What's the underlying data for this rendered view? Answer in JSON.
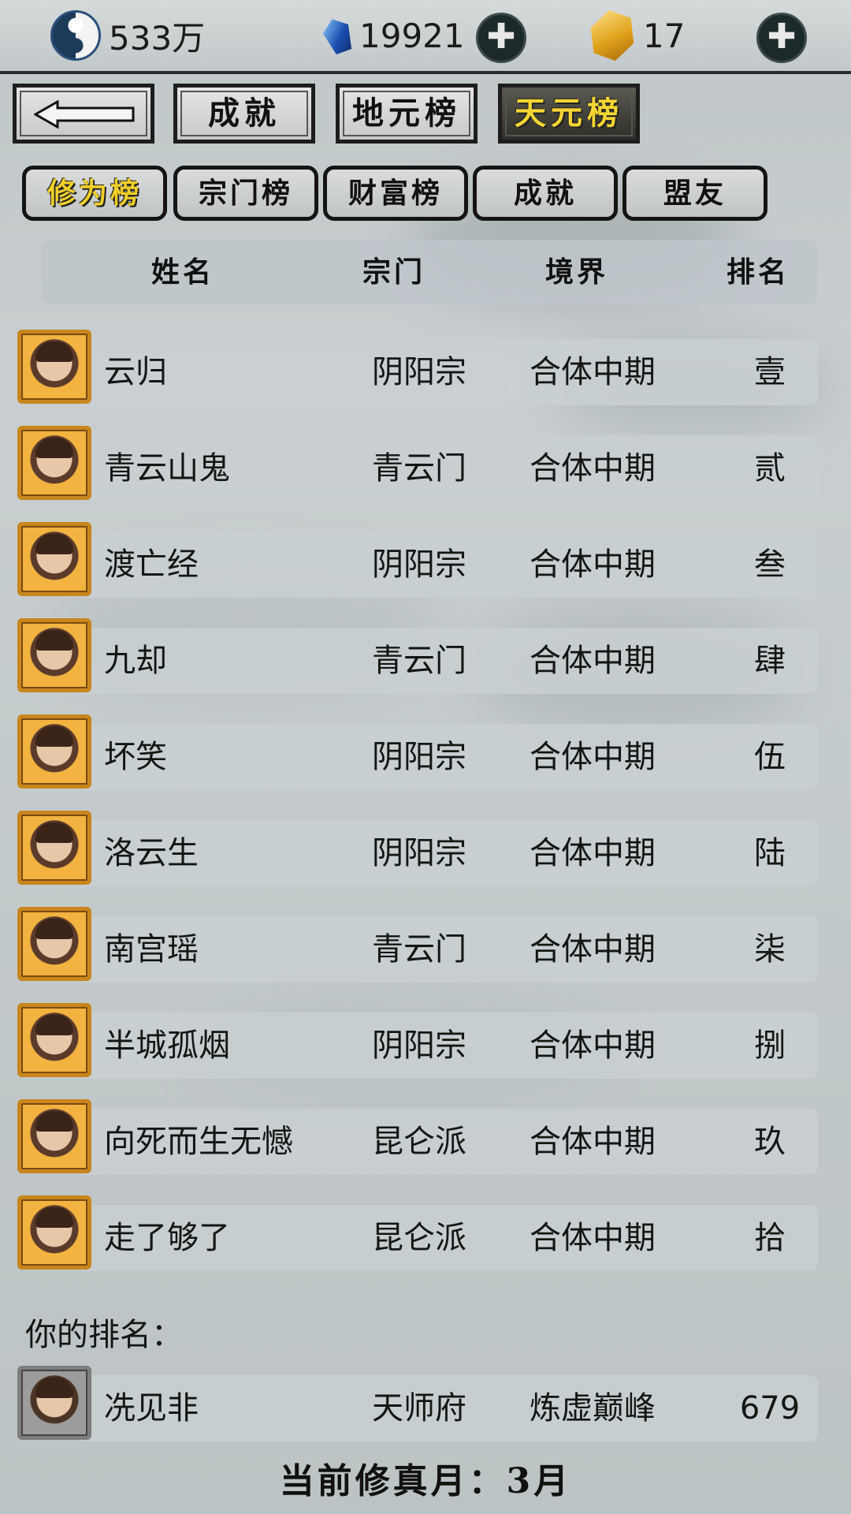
{
  "resources": {
    "spirit_stones": "533万",
    "gems": "19921",
    "gold": "17"
  },
  "main_tabs": {
    "back_label": "",
    "achievements": "成就",
    "earth_ranking": "地元榜",
    "heaven_ranking": "天元榜"
  },
  "sub_tabs": {
    "cultivation": "修为榜",
    "sect": "宗门榜",
    "wealth": "财富榜",
    "achievements": "成就",
    "allies": "盟友"
  },
  "table": {
    "headers": {
      "name": "姓名",
      "sect": "宗门",
      "realm": "境界",
      "rank": "排名"
    },
    "rows": [
      {
        "name": "云归",
        "sect": "阴阳宗",
        "realm": "合体中期",
        "rank": "壹"
      },
      {
        "name": "青云山鬼",
        "sect": "青云门",
        "realm": "合体中期",
        "rank": "贰"
      },
      {
        "name": "渡亡经",
        "sect": "阴阳宗",
        "realm": "合体中期",
        "rank": "叁"
      },
      {
        "name": "九却",
        "sect": "青云门",
        "realm": "合体中期",
        "rank": "肆"
      },
      {
        "name": "坏笑",
        "sect": "阴阳宗",
        "realm": "合体中期",
        "rank": "伍"
      },
      {
        "name": "洛云生",
        "sect": "阴阳宗",
        "realm": "合体中期",
        "rank": "陆"
      },
      {
        "name": "南宫瑶",
        "sect": "青云门",
        "realm": "合体中期",
        "rank": "柒"
      },
      {
        "name": "半城孤烟",
        "sect": "阴阳宗",
        "realm": "合体中期",
        "rank": "捌"
      },
      {
        "name": "向死而生无憾",
        "sect": "昆仑派",
        "realm": "合体中期",
        "rank": "玖"
      },
      {
        "name": "走了够了",
        "sect": "昆仑派",
        "realm": "合体中期",
        "rank": "拾"
      }
    ]
  },
  "self": {
    "label": "你的排名：",
    "name": "冼见非",
    "sect": "天师府",
    "realm": "炼虚巅峰",
    "rank": "679"
  },
  "footer": "当前修真月：3月"
}
